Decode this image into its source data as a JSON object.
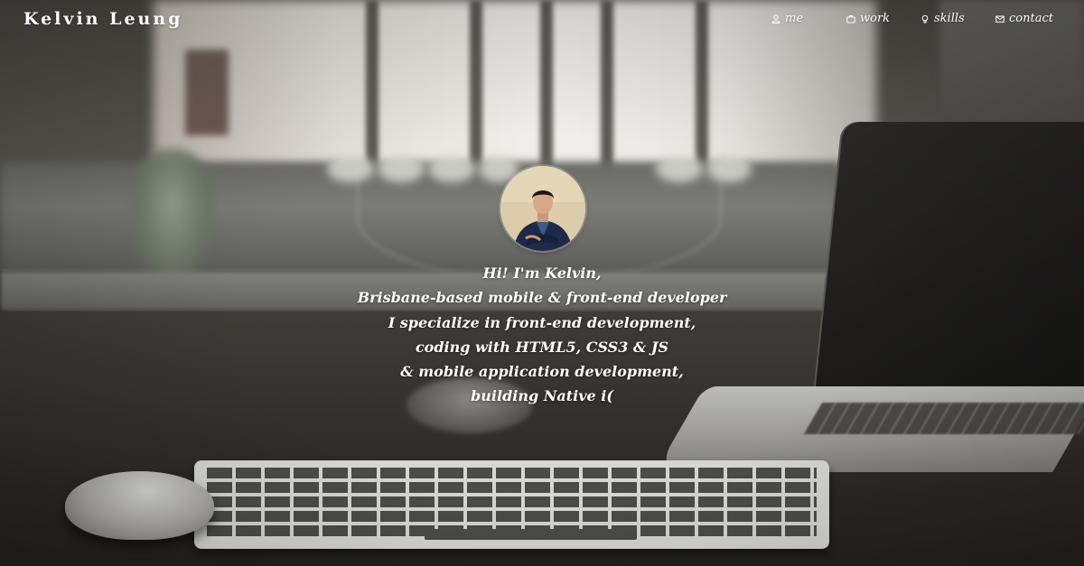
{
  "brand": {
    "name": "Kelvin Leung"
  },
  "nav": {
    "items": [
      {
        "label": "me",
        "icon": "user-icon"
      },
      {
        "label": "work",
        "icon": "briefcase-icon"
      },
      {
        "label": "skills",
        "icon": "lightbulb-icon"
      },
      {
        "label": "contact",
        "icon": "envelope-icon"
      }
    ]
  },
  "intro": {
    "lines": [
      "Hi! I'm Kelvin,",
      "Brisbane-based mobile & front-end developer",
      "I specialize in front-end development,",
      "coding with HTML5, CSS3 & JS",
      "& mobile application development,",
      "building Native i("
    ]
  },
  "colors": {
    "text": "#ffffff",
    "desk": "#2b2826",
    "window": "#e8e6e1"
  }
}
